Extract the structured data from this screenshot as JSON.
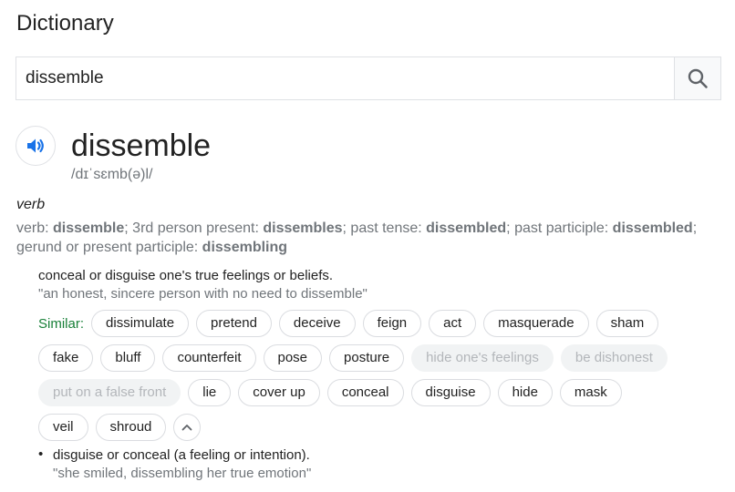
{
  "page": {
    "title": "Dictionary"
  },
  "search": {
    "value": "dissemble"
  },
  "entry": {
    "word": "dissemble",
    "phonetic": "/dɪˈsɛmb(ə)l/",
    "part_of_speech": "verb",
    "forms": {
      "prefix": "verb: ",
      "base": "dissemble",
      "sep1": "; 3rd person present: ",
      "third_person": "dissembles",
      "sep2": "; past tense: ",
      "past": "dissembled",
      "sep3": "; past participle: ",
      "past_participle": "dissembled",
      "sep4": "; gerund or present participle: ",
      "gerund": "dissembling"
    },
    "senses": [
      {
        "definition": "conceal or disguise one's true feelings or beliefs.",
        "example": "\"an honest, sincere person with no need to dissemble\"",
        "similar_label": "Similar:",
        "similar": [
          {
            "label": "dissimulate",
            "muted": false
          },
          {
            "label": "pretend",
            "muted": false
          },
          {
            "label": "deceive",
            "muted": false
          },
          {
            "label": "feign",
            "muted": false
          },
          {
            "label": "act",
            "muted": false
          },
          {
            "label": "masquerade",
            "muted": false
          },
          {
            "label": "sham",
            "muted": false
          },
          {
            "label": "fake",
            "muted": false
          },
          {
            "label": "bluff",
            "muted": false
          },
          {
            "label": "counterfeit",
            "muted": false
          },
          {
            "label": "pose",
            "muted": false
          },
          {
            "label": "posture",
            "muted": false
          },
          {
            "label": "hide one's feelings",
            "muted": true
          },
          {
            "label": "be dishonest",
            "muted": true
          },
          {
            "label": "put on a false front",
            "muted": true
          },
          {
            "label": "lie",
            "muted": false
          },
          {
            "label": "cover up",
            "muted": false
          },
          {
            "label": "conceal",
            "muted": false
          },
          {
            "label": "disguise",
            "muted": false
          },
          {
            "label": "hide",
            "muted": false
          },
          {
            "label": "mask",
            "muted": false
          },
          {
            "label": "veil",
            "muted": false
          },
          {
            "label": "shroud",
            "muted": false
          }
        ]
      },
      {
        "bullet": "•",
        "definition": "disguise or conceal (a feeling or intention).",
        "example": "\"she smiled, dissembling her true emotion\""
      }
    ]
  },
  "icons": {
    "search": "search-icon",
    "speaker": "speaker-icon",
    "collapse": "chevron-up-icon"
  },
  "colors": {
    "accent_blue": "#1a73e8",
    "similar_green": "#188038",
    "muted_text": "#70757a"
  }
}
